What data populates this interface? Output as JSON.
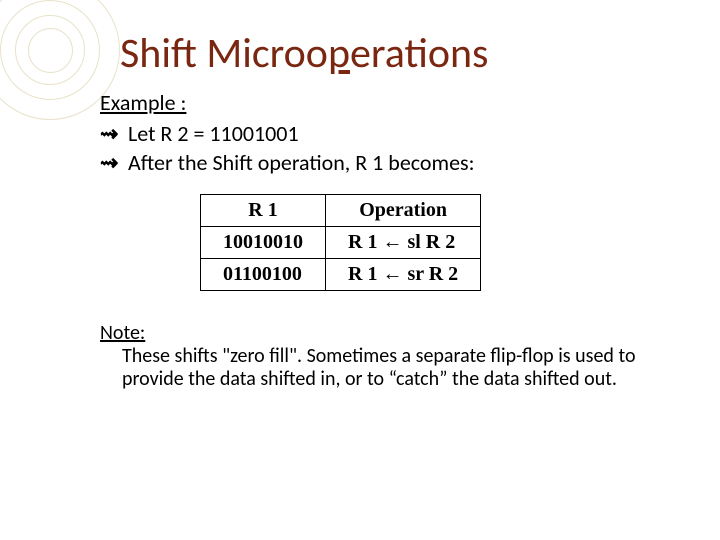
{
  "title_parts": {
    "part1": "Shift",
    "space": "  ",
    "part2": "Microo",
    "part3": "p",
    "part4": "erations"
  },
  "example": {
    "heading": "Example :",
    "line1": "Let R 2 = 11001001",
    "line2": "After the Shift operation, R 1 becomes:"
  },
  "bullet_glyph": "⇝",
  "table": {
    "headers": {
      "col1": "R 1",
      "col2": "Operation"
    },
    "rows": [
      {
        "r1": "10010010",
        "op": "R 1 ← sl R 2"
      },
      {
        "r1": "01100100",
        "op": "R 1 ← sr R 2"
      }
    ]
  },
  "note": {
    "heading": "Note:",
    "body": "These shifts \"zero fill\". Sometimes a separate flip-flop is used to provide the data shifted in, or to “catch” the data shifted out."
  }
}
